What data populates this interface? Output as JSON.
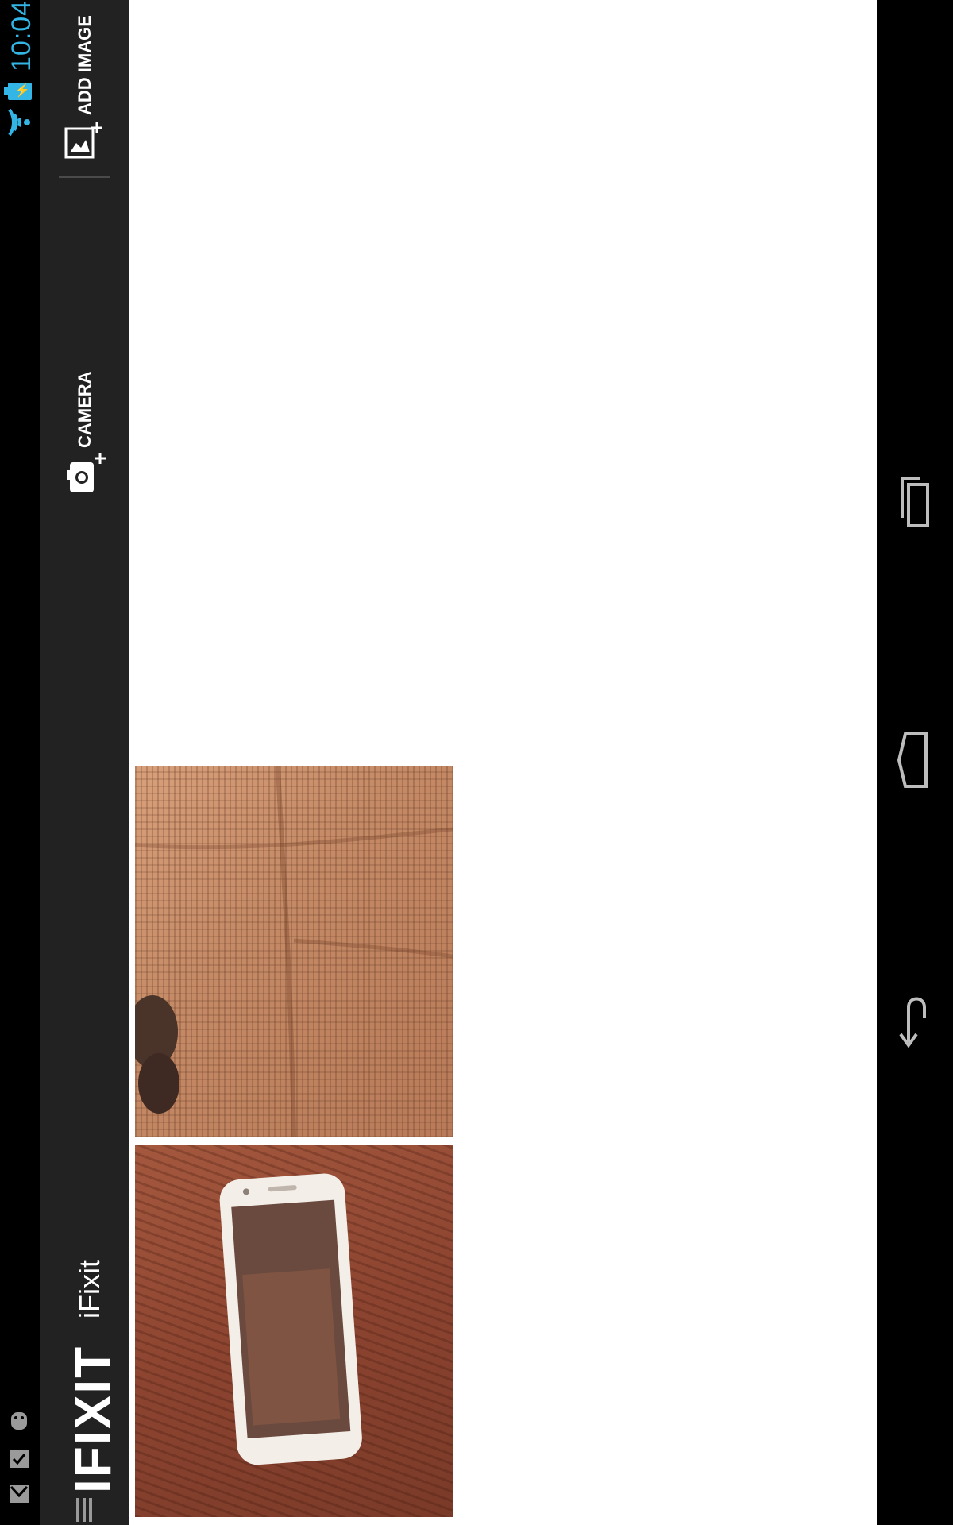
{
  "status_bar": {
    "time": "10:04",
    "battery_symbol": "⚡",
    "icons": [
      "wifi-icon",
      "battery-charging-icon",
      "gmail-icon",
      "download-done-icon",
      "android-icon"
    ]
  },
  "action_bar": {
    "title": "iFixit",
    "logo_text": "IFIXIT",
    "actions": {
      "add_image_label": "ADD IMAGE",
      "camera_label": "CAMERA"
    }
  },
  "gallery": {
    "thumbnails": [
      {
        "name": "photo-carpet",
        "description_icon": "image"
      },
      {
        "name": "photo-phone",
        "description_icon": "image"
      }
    ]
  },
  "nav_bar": {
    "buttons": [
      "recents-button",
      "home-button",
      "back-button"
    ]
  },
  "colors": {
    "status_accent": "#33b5e5",
    "action_bar_bg": "#222222",
    "content_bg": "#ffffff",
    "system_bar_bg": "#000000"
  }
}
